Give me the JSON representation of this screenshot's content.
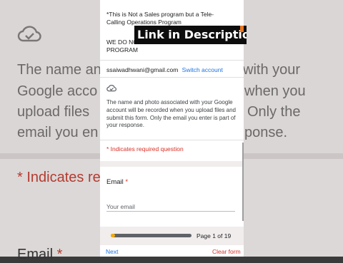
{
  "background": {
    "line1": "The name an",
    "line1_right": "with your",
    "line2": "Google acco",
    "line2_right": "when you",
    "line3": "upload files",
    "line3_right": "Only the",
    "line4": "email you en",
    "line4_right": "ponse.",
    "required": "* Indicates re",
    "email_label": "Email",
    "email_ast": "*"
  },
  "form": {
    "truncated_top": "",
    "notice_line1": "*This is Not a Sales program but a Tele-",
    "notice_line2": "Calling Operations Program",
    "notice_line3": "WE DO NO",
    "notice_line4": "PROGRAM",
    "account_email": "ssaiwadhwani@gmail.com",
    "switch_account": "Switch account",
    "cloud_icon": "cloud-done-icon",
    "description": "The name and photo associated with your Google account will be recorded when you upload files and submit this form. Only the email you enter is part of your response.",
    "required_note": "* Indicates required question",
    "email_label": "Email",
    "email_required_mark": "*",
    "email_placeholder": "Your email",
    "progress_fraction": 0.0526,
    "page_count": "Page 1 of 19",
    "next": "Next",
    "clear_form": "Clear form"
  },
  "overlay": {
    "caption": "Link in Description"
  }
}
